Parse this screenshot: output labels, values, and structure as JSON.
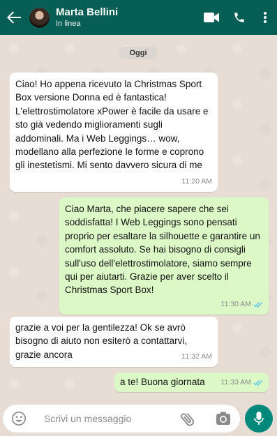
{
  "header": {
    "contact_name": "Marta Bellini",
    "status": "In linea",
    "icons": [
      "back-arrow-icon",
      "video-call-icon",
      "phone-icon",
      "more-vert-icon"
    ],
    "color": "#075e54"
  },
  "chat": {
    "date_label": "Oggi",
    "messages": [
      {
        "direction": "incoming",
        "text": "Ciao! Ho appena ricevuto la Christmas Sport Box versione Donna ed è fantastica! L'elettrostimolatore xPower è facile da usare e sto già vedendo miglioramenti sugli addominali. Ma i Web Leggings… wow, modellano alla perfezione le forme e coprono gli inestetismi. Mi sento davvero sicura di me",
        "time": "11:20 AM"
      },
      {
        "direction": "outgoing",
        "text": "Ciao Marta, che piacere sapere che sei soddisfatta! I Web Leggings sono pensati proprio per esaltare la silhouette e garantire un comfort assoluto. Se hai bisogno di consigli sull'uso dell'elettrostimolatore, siamo sempre qui per aiutarti. Grazie per aver scelto il Christmas Sport Box!",
        "time": "11:30 AM",
        "read": true
      },
      {
        "direction": "incoming",
        "text": "grazie a voi per la gentilezza! Ok se avrò bisogno di aiuto non esiterò a contattarvi, grazie ancora",
        "time": "11:32 AM"
      },
      {
        "direction": "outgoing",
        "text": "a te! Buona giornata",
        "time": "11:33 AM",
        "read": true
      }
    ]
  },
  "composer": {
    "placeholder": "Scrivi un messaggio",
    "icons": [
      "emoji-icon",
      "attach-icon",
      "camera-icon",
      "mic-icon"
    ],
    "accent": "#00897b"
  },
  "colors": {
    "incoming_bubble": "#ffffff",
    "outgoing_bubble": "#dcf8c6",
    "read_ticks": "#4fc3f7",
    "wallpaper": "#e7ddd4"
  }
}
